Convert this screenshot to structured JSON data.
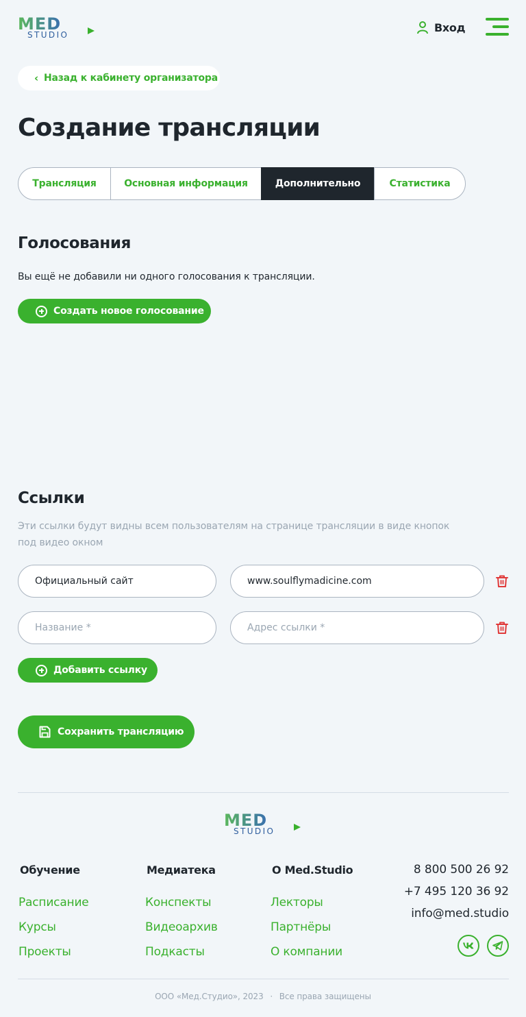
{
  "header": {
    "logo_top": "MED",
    "logo_bottom": "STUDIO",
    "login_label": "Вход",
    "back_label": "Назад к кабинету организатора"
  },
  "page_title": "Создание трансляции",
  "tabs": [
    {
      "label": "Трансляция",
      "active": false
    },
    {
      "label": "Основная информация",
      "active": false
    },
    {
      "label": "Дополнительно",
      "active": true
    },
    {
      "label": "Статистика",
      "active": false
    }
  ],
  "votes": {
    "title": "Голосования",
    "empty_text": "Вы ещё не добавили ни одного голосования к трансляции.",
    "create_button": "Создать новое голосование"
  },
  "links": {
    "title": "Ссылки",
    "description_line1": "Эти ссылки будут видны всем пользователям на странице трансляции в виде кнопок",
    "description_line2": "под видео окном",
    "rows": [
      {
        "name_value": "Официальный сайт",
        "url_value": "www.soulflymadicine.com",
        "name_placeholder": "Название *",
        "url_placeholder": "Адрес ссылки *"
      },
      {
        "name_value": "",
        "url_value": "",
        "name_placeholder": "Название *",
        "url_placeholder": "Адрес ссылки *"
      }
    ],
    "add_button": "Добавить ссылку"
  },
  "save_button": "Сохранить трансляцию",
  "footer": {
    "logo_top": "MED",
    "logo_bottom": "STUDIO",
    "col1": {
      "title": "Обучение",
      "items": [
        "Расписание",
        "Курсы",
        "Проекты"
      ]
    },
    "col2": {
      "title": "Медиатека",
      "items": [
        "Конспекты",
        "Видеоархив",
        "Подкасты"
      ]
    },
    "col3": {
      "title": "О Med.Studio",
      "items": [
        "Лекторы",
        "Партнёры",
        "О компании"
      ]
    },
    "phone1": "8 800 500 26 92",
    "phone2": "+7 495 120 36 92",
    "email": "info@med.studio",
    "social_icons": [
      "vk-icon",
      "telegram-icon"
    ],
    "copyright_company": "ООО «Мед.Студио», 2023",
    "copyright_sep": "·",
    "copyright_rights": "Все права защищены"
  },
  "colors": {
    "accent": "#3ab12e",
    "dark": "#1f262d",
    "logo_blue": "#2f5e9e",
    "danger": "#e03a3a",
    "background": "#f2f6f9"
  }
}
